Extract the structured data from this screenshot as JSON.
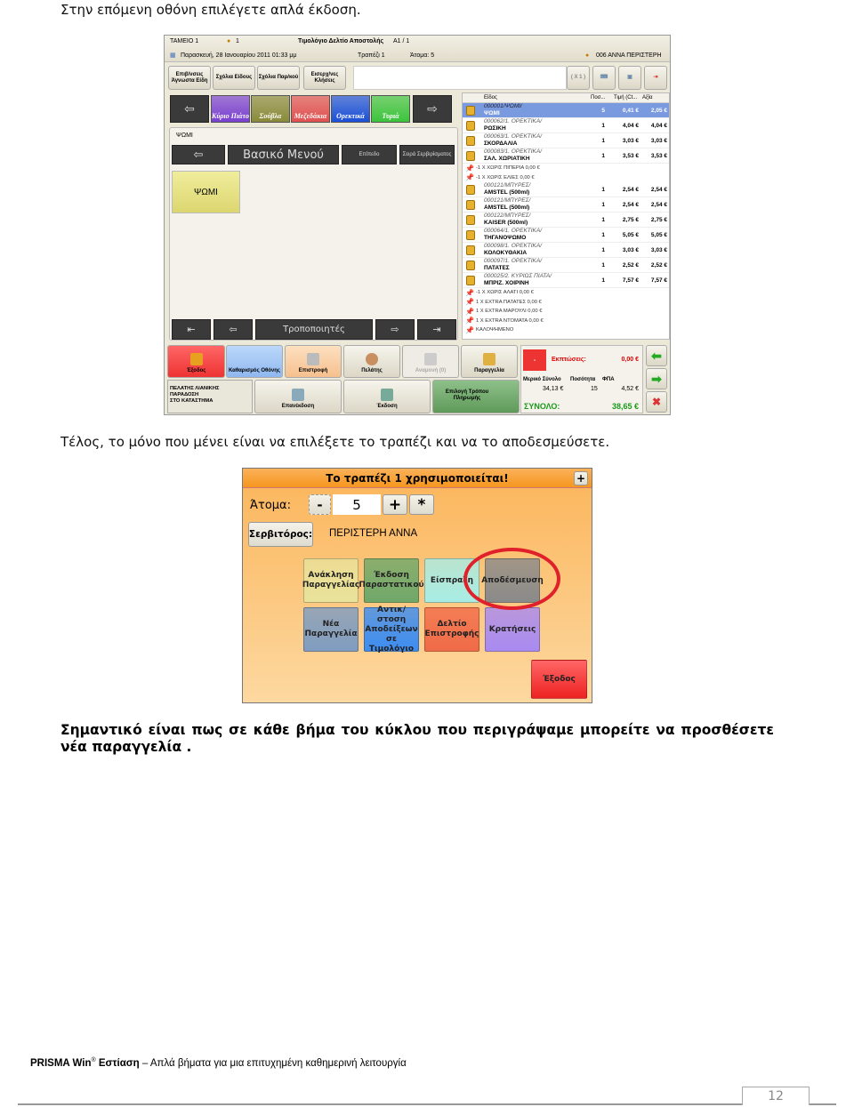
{
  "intro_text": "Στην επόμενη οθόνη επιλέγετε απλά έκδοση.",
  "pos_screen": {
    "header": {
      "station": "ΤΑΜΕΙΟ 1",
      "user_count": "1",
      "document_title": "Τιμολόγιο Δελτίο Αποστολής",
      "document_series": "Α1 / 1",
      "date": "Παρασκευή, 28 Ιανουαρίου 2011 01:33 μμ",
      "table": "Τραπέζι 1",
      "persons": "Άτομα: 5",
      "waiter": "006 ΑΝΝΑ ΠΕΡΙΣΤΕΡΗ"
    },
    "toolbar": [
      "Επιβ/νσεις Άγνωστα Είδη",
      "Σχόλια Είδους",
      "Σχόλια Παρ/κού",
      "Εισερχ/νες Κλήσεις"
    ],
    "multiplier": "( X 1 )",
    "categories": [
      {
        "label": "Κύριο Πιάτο",
        "color": "#7a3fd0"
      },
      {
        "label": "Σούβλα",
        "color": "#8a8a3a"
      },
      {
        "label": "Μεζεδάκια",
        "color": "#e05050"
      },
      {
        "label": "Ορεκτικά",
        "color": "#1a4fd8"
      },
      {
        "label": "Τυριά",
        "color": "#3cc43c"
      }
    ],
    "left_panel": {
      "tab": "ΨΩΜΙ",
      "menu_title": "Βασικό Μενού",
      "level": "Επίπεδο",
      "serving_order": "Σειρά Σερβιρίσματος",
      "item_tile": "ΨΩΜΙ",
      "modifiers": "Τροποποιητές"
    },
    "order_list": {
      "columns": [
        "Είδος",
        "Ποσ...",
        "Τιμή (Ct...",
        "Αξία"
      ],
      "lines": [
        {
          "type": "item",
          "code": "000001/ΨΩΜΙ/",
          "name": "ΨΩΜΙ",
          "qty": "5",
          "price": "0,41 €",
          "value": "2,05 €",
          "selected": true
        },
        {
          "type": "item",
          "code": "000062/1. ΟΡΕΚΤΙΚΑ/",
          "name": "ΡΩΣΙΚΗ",
          "qty": "1",
          "price": "4,04 €",
          "value": "4,04 €"
        },
        {
          "type": "item",
          "code": "000063/1. ΟΡΕΚΤΙΚΑ/",
          "name": "ΣΚΟΡΔΑΛΙΑ",
          "qty": "1",
          "price": "3,03 €",
          "value": "3,03 €"
        },
        {
          "type": "item",
          "code": "000083/1. ΟΡΕΚΤΙΚΑ/",
          "name": "ΣΑΛ. ΧΩΡΙΑΤΙΚΗ",
          "qty": "1",
          "price": "3,53 €",
          "value": "3,53 €"
        },
        {
          "type": "mod",
          "text": "-1 X ΧΩΡΙΣ ΠΙΠΕΡΙΑ    0,00 €"
        },
        {
          "type": "mod",
          "text": "-1 X ΧΩΡΙΣ ΕΛΙΕΣ    0,00 €"
        },
        {
          "type": "item",
          "code": "000121/ΜΠΥΡΕΣ/",
          "name": "AMSTEL (500ml)",
          "qty": "1",
          "price": "2,54 €",
          "value": "2,54 €"
        },
        {
          "type": "item",
          "code": "000121/ΜΠΥΡΕΣ/",
          "name": "AMSTEL (500ml)",
          "qty": "1",
          "price": "2,54 €",
          "value": "2,54 €"
        },
        {
          "type": "item",
          "code": "000122/ΜΠΥΡΕΣ/",
          "name": "KAISER (500ml)",
          "qty": "1",
          "price": "2,75 €",
          "value": "2,75 €"
        },
        {
          "type": "item",
          "code": "000064/1. ΟΡΕΚΤΙΚΑ/",
          "name": "ΤΗΓΑΝΟΨΩΜΟ",
          "qty": "1",
          "price": "5,05 €",
          "value": "5,05 €"
        },
        {
          "type": "item",
          "code": "000098/1. ΟΡΕΚΤΙΚΑ/",
          "name": "ΚΟΛΟΚΥΘΑΚΙΑ",
          "qty": "1",
          "price": "3,03 €",
          "value": "3,03 €"
        },
        {
          "type": "item",
          "code": "000097/1. ΟΡΕΚΤΙΚΑ/",
          "name": "ΠΑΤΑΤΕΣ",
          "qty": "1",
          "price": "2,52 €",
          "value": "2,52 €"
        },
        {
          "type": "item",
          "code": "000025/2. ΚΥΡΙΩΣ ΠΙΑΤΑ/",
          "name": "ΜΠΡΙΖ. ΧΟΙΡΙΝΗ",
          "qty": "1",
          "price": "7,57 €",
          "value": "7,57 €"
        },
        {
          "type": "mod",
          "text": "-1 X ΧΩΡΙΣ ΑΛΑΤΙ    0,00 €"
        },
        {
          "type": "mod",
          "text": "1 X EXTRA ΠΑΤΑΤΕΣ    0,00 €"
        },
        {
          "type": "mod",
          "text": "1 X EXTRA ΜΑΡΟΥΛΙ    0,00 €"
        },
        {
          "type": "mod",
          "text": "1 X EXTRA ΝΤΟΜΑΤΑ    0,00 €"
        },
        {
          "type": "mod",
          "text": "ΚΑΛΟΨΗΜΕΝΟ"
        }
      ]
    },
    "bottom_buttons": {
      "exit": "Έξοδος",
      "clear": "Καθαρισμός Οθόνης",
      "return": "Επιστροφή",
      "customer": "Πελάτης",
      "pending": "Αναμονή (0)",
      "order": "Παραγγελία",
      "customer_info": "ΠΕΛΑΤΗΣ ΛΙΑΝΙΚΗΣ\nΠΑΡΑΔΟΣΗ\nΣΤΟ ΚΑΤΑΣΤΗΜΑ",
      "reissue": "Επανέκδοση",
      "issue": "Έκδοση",
      "payment": "Επιλογή Τρόπου Πληρωμής"
    },
    "totals": {
      "discount_button": "-",
      "discount_label": "Εκπτώσεις:",
      "discount_value": "0,00 €",
      "subtotal_label": "Μερικό Σύνολο",
      "subtotal": "34,13 €",
      "quantity_label": "Ποσότητα",
      "quantity": "15",
      "vat_label": "ΦΠΑ",
      "vat": "4,52 €",
      "total_label": "ΣΥΝΟΛΟ:",
      "total": "38,65 €"
    }
  },
  "second_text": "Τέλος, το μόνο που μένει είναι να επιλέξετε το τραπέζι και να το αποδεσμεύσετε.",
  "table_dialog": {
    "title": "Το τραπέζι 1 χρησιμοποιείται!",
    "plus_corner": "+",
    "persons_label": "Άτομα:",
    "minus": "-",
    "persons_value": "5",
    "plus": "+",
    "star": "*",
    "waiter_button": "Σερβιτόρος:",
    "waiter_name": "ΠΕΡΙΣΤΕΡΗ ΑΝΝΑ",
    "buttons": [
      {
        "label": "Ανάκληση Παραγγελίας",
        "color": "#e8e29a"
      },
      {
        "label": "Έκδοση Παραστατικού",
        "color": "#6fa86a"
      },
      {
        "label": "Είσπραξη",
        "color": "#a8ece4"
      },
      {
        "label": "Αποδέσμευση",
        "color": "#8a8a8a",
        "highlighted": true
      },
      {
        "label": "Νέα Παραγγελία",
        "color": "#7f9cc0"
      },
      {
        "label": "Αντικ/στοση Αποδείξεων σε Τιμολόγιο",
        "color": "#3c8cf0"
      },
      {
        "label": "Δελτίο Επιστροφής",
        "color": "#f06a48"
      },
      {
        "label": "Κρατήσεις",
        "color": "#a88af0"
      }
    ],
    "exit": "Έξοδος",
    "highlight_color": "#e0202a"
  },
  "important_note": "Σημαντικό είναι πως σε κάθε βήμα του κύκλου που περιγράψαμε μπορείτε να προσθέσετε νέα παραγγελία .",
  "footer": {
    "brand": "PRISMA Win",
    "registered": "®",
    "product": "Εστίαση",
    "tagline": "– Απλά βήματα για μια επιτυχημένη καθημερινή λειτουργία",
    "page_number": "12"
  }
}
